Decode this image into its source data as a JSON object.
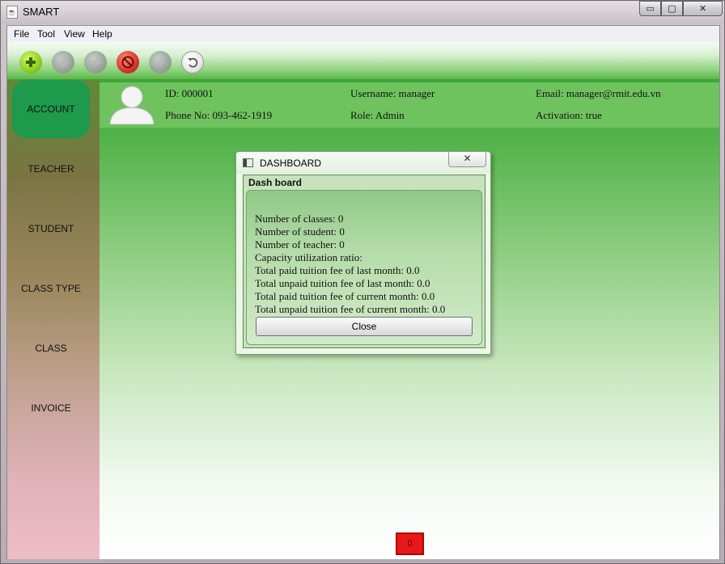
{
  "window": {
    "title": "SMART",
    "app_icon": "java-cup-icon",
    "min_glyph": "▭",
    "max_glyph": "▢",
    "close_glyph": "✕"
  },
  "menubar": {
    "items": [
      "File",
      "Tool",
      "View",
      "Help"
    ]
  },
  "toolbar": {
    "buttons": [
      {
        "icon": "add-icon",
        "state": "enabled",
        "color": "#8ccf1f"
      },
      {
        "icon": "settings-icon",
        "state": "disabled",
        "color": "#9aa29a"
      },
      {
        "icon": "remove-icon",
        "state": "disabled",
        "color": "#9aa29a"
      },
      {
        "icon": "block-icon",
        "state": "enabled",
        "color": "#d9342b"
      },
      {
        "icon": "info-icon",
        "state": "disabled",
        "color": "#9aa29a"
      },
      {
        "icon": "undo-icon",
        "state": "enabled",
        "color": "#e8e8e8"
      }
    ]
  },
  "sidebar": {
    "items": [
      {
        "label": "ACCOUNT",
        "active": true
      },
      {
        "label": "TEACHER",
        "active": false
      },
      {
        "label": "STUDENT",
        "active": false
      },
      {
        "label": "CLASS TYPE",
        "active": false
      },
      {
        "label": "CLASS",
        "active": false
      },
      {
        "label": "INVOICE",
        "active": false
      }
    ],
    "active_color": "#1d9a4b"
  },
  "user": {
    "id": "ID: 000001",
    "phone": "Phone No: 093-462-1919",
    "username": "Username: manager",
    "role": "Role: Admin",
    "email": "Email: manager@rmit.edu.vn",
    "activation": "Activation: true"
  },
  "dialog": {
    "title": "DASHBOARD",
    "close_glyph": "✕",
    "group_title": "Dash board",
    "lines": [
      "Number of classes: 0",
      "Number of student: 0",
      "Number of teacher: 0",
      "Capacity utilization ratio:",
      "Total paid tuition fee of last month: 0.0",
      "Total unpaid tuition fee of last month: 0.0",
      "Total paid tuition fee of current month: 0.0",
      "Total unpaid tuition fee of current month: 0.0"
    ],
    "close_button": "Close"
  },
  "status": {
    "counter": "0",
    "counter_color": "#e81818"
  }
}
